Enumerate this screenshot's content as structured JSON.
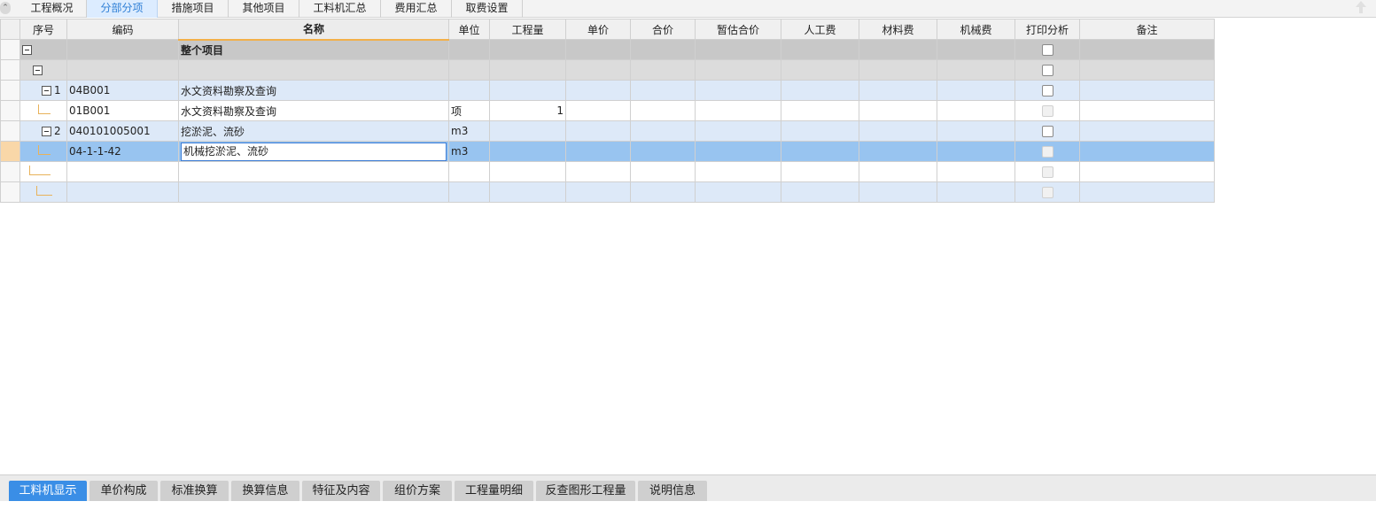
{
  "top_tabs": [
    "工程概况",
    "分部分项",
    "措施项目",
    "其他项目",
    "工料机汇总",
    "费用汇总",
    "取费设置"
  ],
  "active_top_tab": "分部分项",
  "columns": [
    "序号",
    "编码",
    "名称",
    "单位",
    "工程量",
    "单价",
    "合价",
    "暂估合价",
    "人工费",
    "材料费",
    "机械费",
    "打印分析",
    "备注"
  ],
  "rows": [
    {
      "seq": "",
      "code": "",
      "name": "整个项目",
      "unit": "",
      "qty": ""
    },
    {
      "seq": "",
      "code": "",
      "name": "",
      "unit": "",
      "qty": ""
    },
    {
      "seq": "1",
      "code": "04B001",
      "name": "水文资料勘察及查询",
      "unit": "",
      "qty": ""
    },
    {
      "seq": "",
      "code": "01B001",
      "name": "水文资料勘察及查询",
      "unit": "项",
      "qty": "1"
    },
    {
      "seq": "2",
      "code": "040101005001",
      "name": "挖淤泥、流砂",
      "unit": "m3",
      "qty": ""
    },
    {
      "seq": "",
      "code": "04-1-1-42",
      "name": "机械挖淤泥、流砂",
      "unit": "m3",
      "qty": ""
    },
    {
      "seq": "",
      "code": "",
      "name": "",
      "unit": "",
      "qty": ""
    },
    {
      "seq": "",
      "code": "",
      "name": "",
      "unit": "",
      "qty": ""
    }
  ],
  "bottom_tabs": [
    "工料机显示",
    "单价构成",
    "标准换算",
    "换算信息",
    "特征及内容",
    "组价方案",
    "工程量明细",
    "反查图形工程量",
    "说明信息"
  ],
  "active_bottom_tab": "工料机显示",
  "colors": {
    "accent": "#3a8ee6",
    "selected_row": "#98c4f0",
    "total_row": "#c8c8c8",
    "light_blue_row": "#dde9f8"
  }
}
